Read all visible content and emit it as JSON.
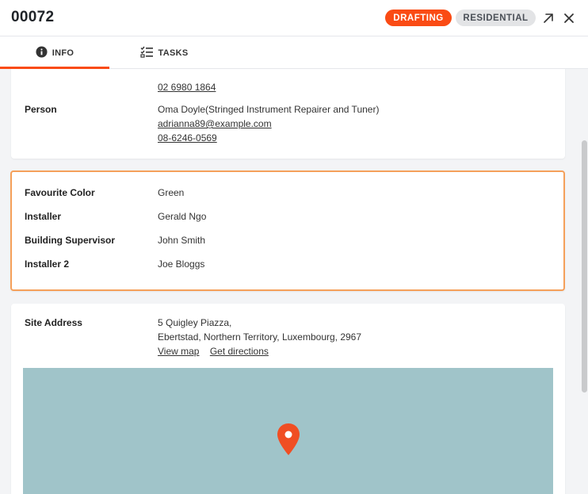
{
  "header": {
    "job_number": "00072",
    "status_badge": "DRAFTING",
    "type_badge": "RESIDENTIAL",
    "expand_icon": "arrow-up-right-icon",
    "close_icon": "close-icon"
  },
  "tabs": [
    {
      "label": "INFO",
      "icon": "info-circle-icon",
      "active": true
    },
    {
      "label": "TASKS",
      "icon": "checklist-icon",
      "active": false
    }
  ],
  "contacts": {
    "partial_phone": "02 6980 1864",
    "person": {
      "label": "Person",
      "name": "Oma Doyle(Stringed Instrument Repairer and Tuner)",
      "email": "adrianna89@example.com",
      "phone": "08-6246-0569"
    }
  },
  "custom_fields": [
    {
      "label": "Favourite Color",
      "value": "Green"
    },
    {
      "label": "Installer",
      "value": "Gerald Ngo"
    },
    {
      "label": "Building Supervisor",
      "value": "John Smith"
    },
    {
      "label": "Installer 2",
      "value": "Joe Bloggs"
    }
  ],
  "site": {
    "label": "Site Address",
    "line1": "5 Quigley Piazza,",
    "line2": "Ebertstad, Northern Territory, Luxembourg, 2967",
    "view_map": "View map",
    "get_directions": "Get directions"
  },
  "colors": {
    "accent": "#fa4b14",
    "highlight_border": "#f5a05a",
    "map_water": "#a0c4c9"
  }
}
